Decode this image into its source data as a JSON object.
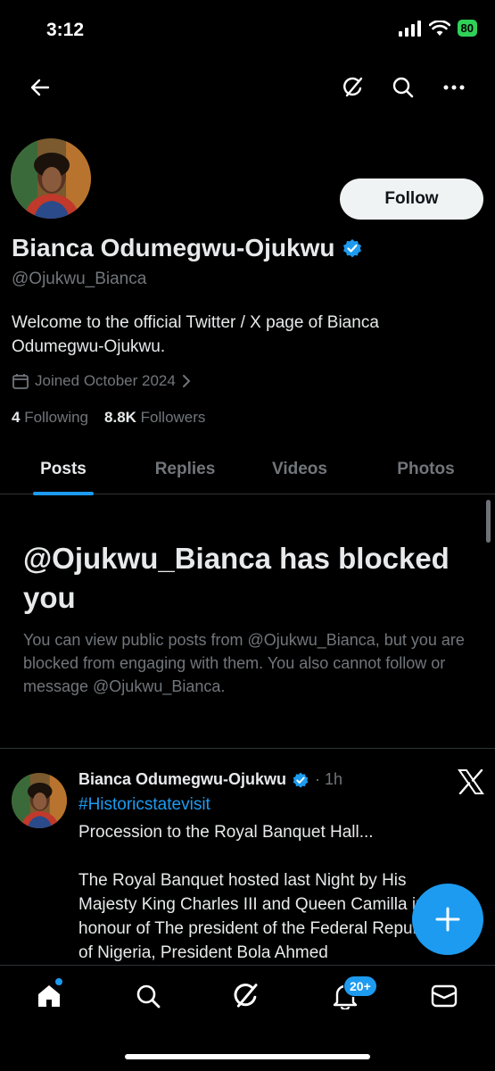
{
  "status_bar": {
    "time": "3:12",
    "battery": "80"
  },
  "profile": {
    "follow_label": "Follow",
    "display_name": "Bianca Odumegwu-Ojukwu",
    "handle": "@Ojukwu_Bianca",
    "bio": "Welcome to the official Twitter / X page of Bianca Odumegwu-Ojukwu.",
    "joined": "Joined October 2024",
    "following_count": "4",
    "following_label": "Following",
    "followers_count": "8.8K",
    "followers_label": "Followers"
  },
  "tabs": [
    {
      "label": "Posts",
      "active": true
    },
    {
      "label": "Replies",
      "active": false
    },
    {
      "label": "Videos",
      "active": false
    },
    {
      "label": "Photos",
      "active": false
    }
  ],
  "blocked": {
    "title": "@Ojukwu_Bianca has blocked you",
    "description": "You can view public posts from @Ojukwu_Bianca, but you are blocked from engaging with them. You also cannot follow or message @Ojukwu_Bianca."
  },
  "tweet": {
    "author": "Bianca Odumegwu-Ojukwu",
    "meta": "· 1h",
    "hashtag": "#Historicstatevisit",
    "text": "Procession to the Royal Banquet Hall...\n\nThe Royal Banquet hosted last Night by His Majesty King Charles III and Queen Camilla in honour of The president of the  Federal Republic of Nigeria, President Bola Ahmed"
  },
  "bottom_nav": {
    "notifications_badge": "20+"
  },
  "colors": {
    "accent": "#1d9bf0",
    "background": "#000000",
    "muted": "#71767b",
    "verified": "#1d9bf0",
    "battery": "#30d158"
  },
  "icons": [
    "back-arrow-icon",
    "grok-icon",
    "search-icon",
    "more-icon",
    "calendar-icon",
    "chevron-right-icon",
    "verified-badge-icon",
    "x-logo-icon",
    "plus-icon",
    "home-icon",
    "bell-icon",
    "mail-icon"
  ]
}
